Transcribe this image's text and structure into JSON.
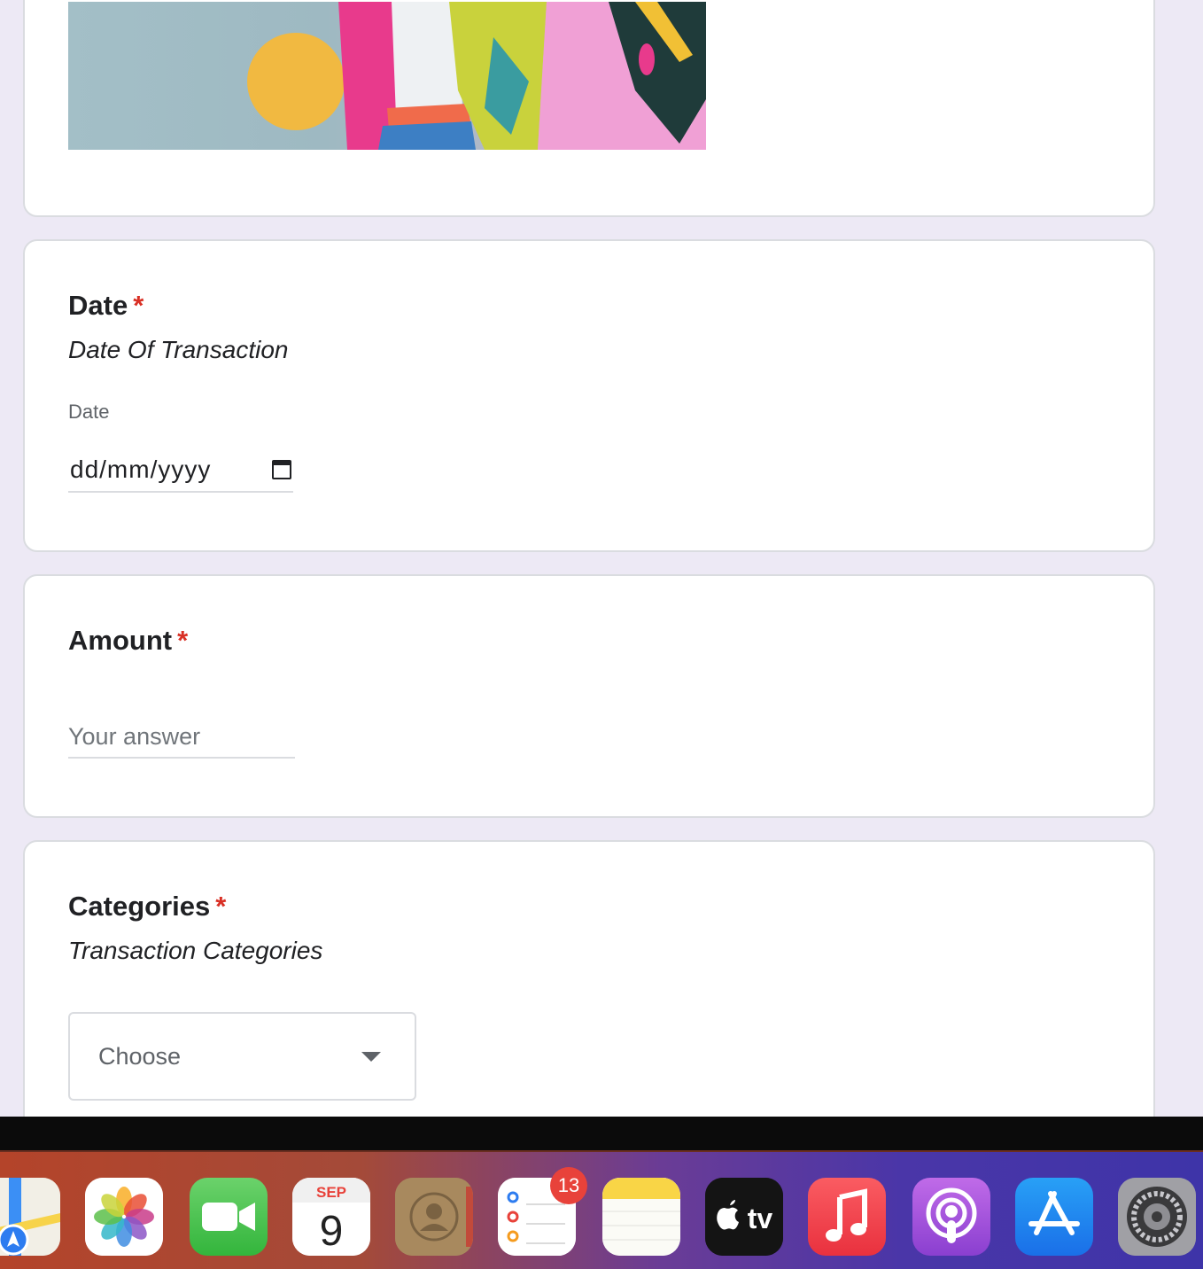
{
  "questions": {
    "date": {
      "title": "Date",
      "required_mark": "*",
      "description": "Date Of Transaction",
      "field_label": "Date",
      "placeholder": "dd/mm/yyyy"
    },
    "amount": {
      "title": "Amount",
      "required_mark": "*",
      "placeholder": "Your answer"
    },
    "categories": {
      "title": "Categories",
      "required_mark": "*",
      "description": "Transaction Categories",
      "selected": "Choose"
    }
  },
  "dock": {
    "apps": [
      {
        "name": "Maps",
        "icon": "maps-icon"
      },
      {
        "name": "Photos",
        "icon": "photos-icon"
      },
      {
        "name": "FaceTime",
        "icon": "facetime-icon"
      },
      {
        "name": "Calendar",
        "icon": "calendar-icon",
        "month": "SEP",
        "day": "9"
      },
      {
        "name": "Contacts",
        "icon": "contacts-icon"
      },
      {
        "name": "Reminders",
        "icon": "reminders-icon",
        "badge": "13"
      },
      {
        "name": "Notes",
        "icon": "notes-icon"
      },
      {
        "name": "TV",
        "icon": "tv-icon",
        "label": "tv"
      },
      {
        "name": "Music",
        "icon": "music-icon"
      },
      {
        "name": "Podcasts",
        "icon": "podcasts-icon"
      },
      {
        "name": "App Store",
        "icon": "app-store-icon"
      },
      {
        "name": "System Settings",
        "icon": "settings-icon"
      }
    ]
  },
  "colors": {
    "page_background": "#ede9f5",
    "required": "#d93025",
    "card_border": "#dadce0"
  }
}
